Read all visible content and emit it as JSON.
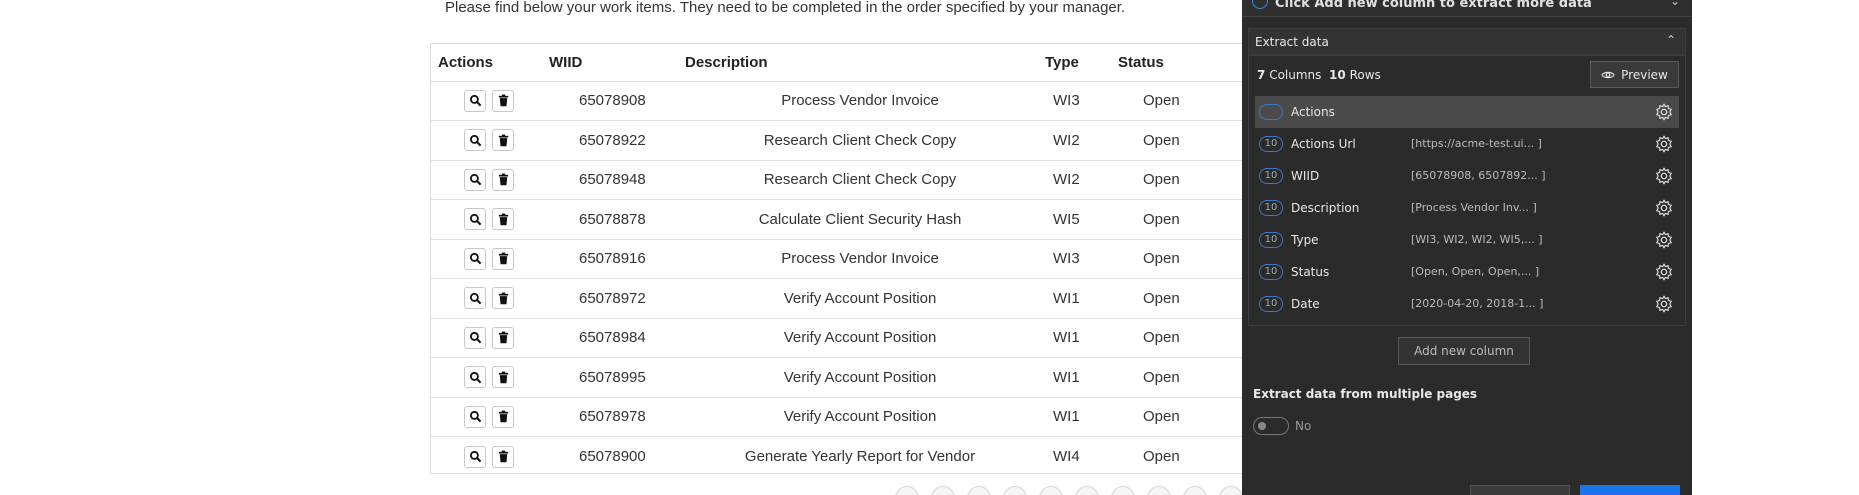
{
  "intro_text": "Please find below your work items. They need to be completed in the order specified by your manager.",
  "table": {
    "headers": {
      "actions": "Actions",
      "wiid": "WIID",
      "description": "Description",
      "type": "Type",
      "status": "Status"
    },
    "rows": [
      {
        "wiid": "65078908",
        "description": "Process Vendor Invoice",
        "type": "WI3",
        "status": "Open"
      },
      {
        "wiid": "65078922",
        "description": "Research Client Check Copy",
        "type": "WI2",
        "status": "Open"
      },
      {
        "wiid": "65078948",
        "description": "Research Client Check Copy",
        "type": "WI2",
        "status": "Open"
      },
      {
        "wiid": "65078878",
        "description": "Calculate Client Security Hash",
        "type": "WI5",
        "status": "Open"
      },
      {
        "wiid": "65078916",
        "description": "Process Vendor Invoice",
        "type": "WI3",
        "status": "Open"
      },
      {
        "wiid": "65078972",
        "description": "Verify Account Position",
        "type": "WI1",
        "status": "Open"
      },
      {
        "wiid": "65078984",
        "description": "Verify Account Position",
        "type": "WI1",
        "status": "Open"
      },
      {
        "wiid": "65078995",
        "description": "Verify Account Position",
        "type": "WI1",
        "status": "Open"
      },
      {
        "wiid": "65078978",
        "description": "Verify Account Position",
        "type": "WI1",
        "status": "Open"
      },
      {
        "wiid": "65078900",
        "description": "Generate Yearly Report for Vendor",
        "type": "WI4",
        "status": "Open"
      }
    ],
    "row_icons": [
      "search-icon",
      "trash-icon"
    ]
  },
  "panel": {
    "hint": "Click Add new column to extract more data",
    "section_title": "Extract data",
    "columns_count": "7",
    "columns_label": "Columns",
    "rows_count": "10",
    "rows_label": "Rows",
    "preview_label": "Preview",
    "columns": [
      {
        "badge": "10",
        "name": "Actions",
        "preview": ""
      },
      {
        "badge": "10",
        "name": "Actions Url",
        "preview": "[https://acme-test.ui...  ]"
      },
      {
        "badge": "10",
        "name": "WIID",
        "preview": "[65078908, 6507892...  ]"
      },
      {
        "badge": "10",
        "name": "Description",
        "preview": "[Process Vendor Inv...  ]"
      },
      {
        "badge": "10",
        "name": "Type",
        "preview": "[WI3, WI2, WI2, WI5,...  ]"
      },
      {
        "badge": "10",
        "name": "Status",
        "preview": "[Open, Open, Open,...  ]"
      },
      {
        "badge": "10",
        "name": "Date",
        "preview": "[2020-04-20, 2018-1...  ]"
      }
    ],
    "add_column_label": "Add new column",
    "multi_page_label": "Extract data from multiple pages",
    "toggle_label": "No",
    "colors": {
      "panel_bg": "#2b2b2b",
      "accent": "#1a73e8",
      "badge_border": "#3b7bc4"
    }
  }
}
